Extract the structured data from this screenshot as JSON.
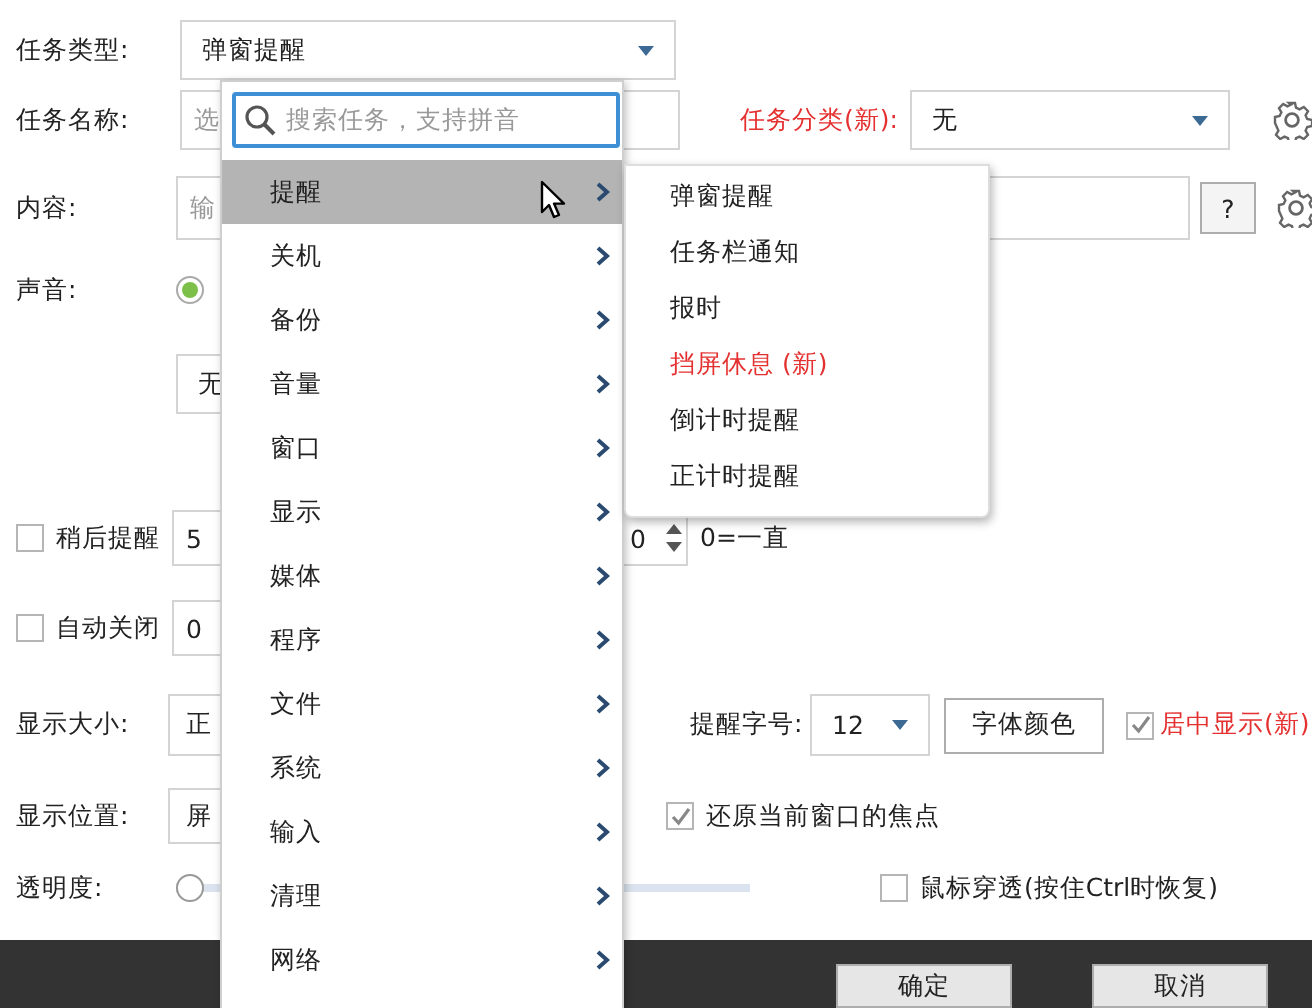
{
  "form": {
    "task_type": {
      "label": "任务类型:",
      "value": "弹窗提醒"
    },
    "task_name": {
      "label": "任务名称:",
      "placeholder": "选"
    },
    "category": {
      "label": "任务分类(新):",
      "new": true,
      "value": "无"
    },
    "content": {
      "label": "内容:",
      "placeholder": "输",
      "help_button": "?"
    },
    "sound": {
      "label": "声音:",
      "selected": true
    },
    "sound_choice": {
      "value": "无"
    },
    "snooze": {
      "label": "稍后提醒",
      "checked": false,
      "value": "5"
    },
    "repeat": {
      "value": "0",
      "hint": "0=一直"
    },
    "auto_close": {
      "label": "自动关闭",
      "checked": false,
      "value": "0"
    },
    "display_size": {
      "label": "显示大小:",
      "value": "正"
    },
    "font_size": {
      "label": "提醒字号:",
      "value": "12"
    },
    "font_color_button": "字体颜色",
    "center": {
      "label": "居中显示(新)",
      "checked": true,
      "new": true
    },
    "display_position": {
      "label": "显示位置:",
      "value": "屏"
    },
    "restore_focus": {
      "label": "还原当前窗口的焦点",
      "checked": true
    },
    "opacity": {
      "label": "透明度:",
      "level": 0
    },
    "click_through": {
      "label": "鼠标穿透(按住Ctrl时恢复)",
      "checked": false
    }
  },
  "buttons": [
    "确定",
    "取消"
  ],
  "menu": {
    "search": {
      "placeholder": "搜索任务，支持拼音"
    },
    "items": [
      {
        "label": "提醒",
        "selected": true
      },
      {
        "label": "关机",
        "selected": false
      },
      {
        "label": "备份",
        "selected": false
      },
      {
        "label": "音量",
        "selected": false
      },
      {
        "label": "窗口",
        "selected": false
      },
      {
        "label": "显示",
        "selected": false
      },
      {
        "label": "媒体",
        "selected": false
      },
      {
        "label": "程序",
        "selected": false
      },
      {
        "label": "文件",
        "selected": false
      },
      {
        "label": "系统",
        "selected": false
      },
      {
        "label": "输入",
        "selected": false
      },
      {
        "label": "清理",
        "selected": false
      },
      {
        "label": "网络",
        "selected": false
      }
    ]
  },
  "submenu": {
    "items": [
      {
        "label": "弹窗提醒",
        "new": false
      },
      {
        "label": "任务栏通知",
        "new": false
      },
      {
        "label": "报时",
        "new": false
      },
      {
        "label": "挡屏休息 (新)",
        "new": true
      },
      {
        "label": "倒计时提醒",
        "new": false
      },
      {
        "label": "正计时提醒",
        "new": false
      }
    ]
  }
}
